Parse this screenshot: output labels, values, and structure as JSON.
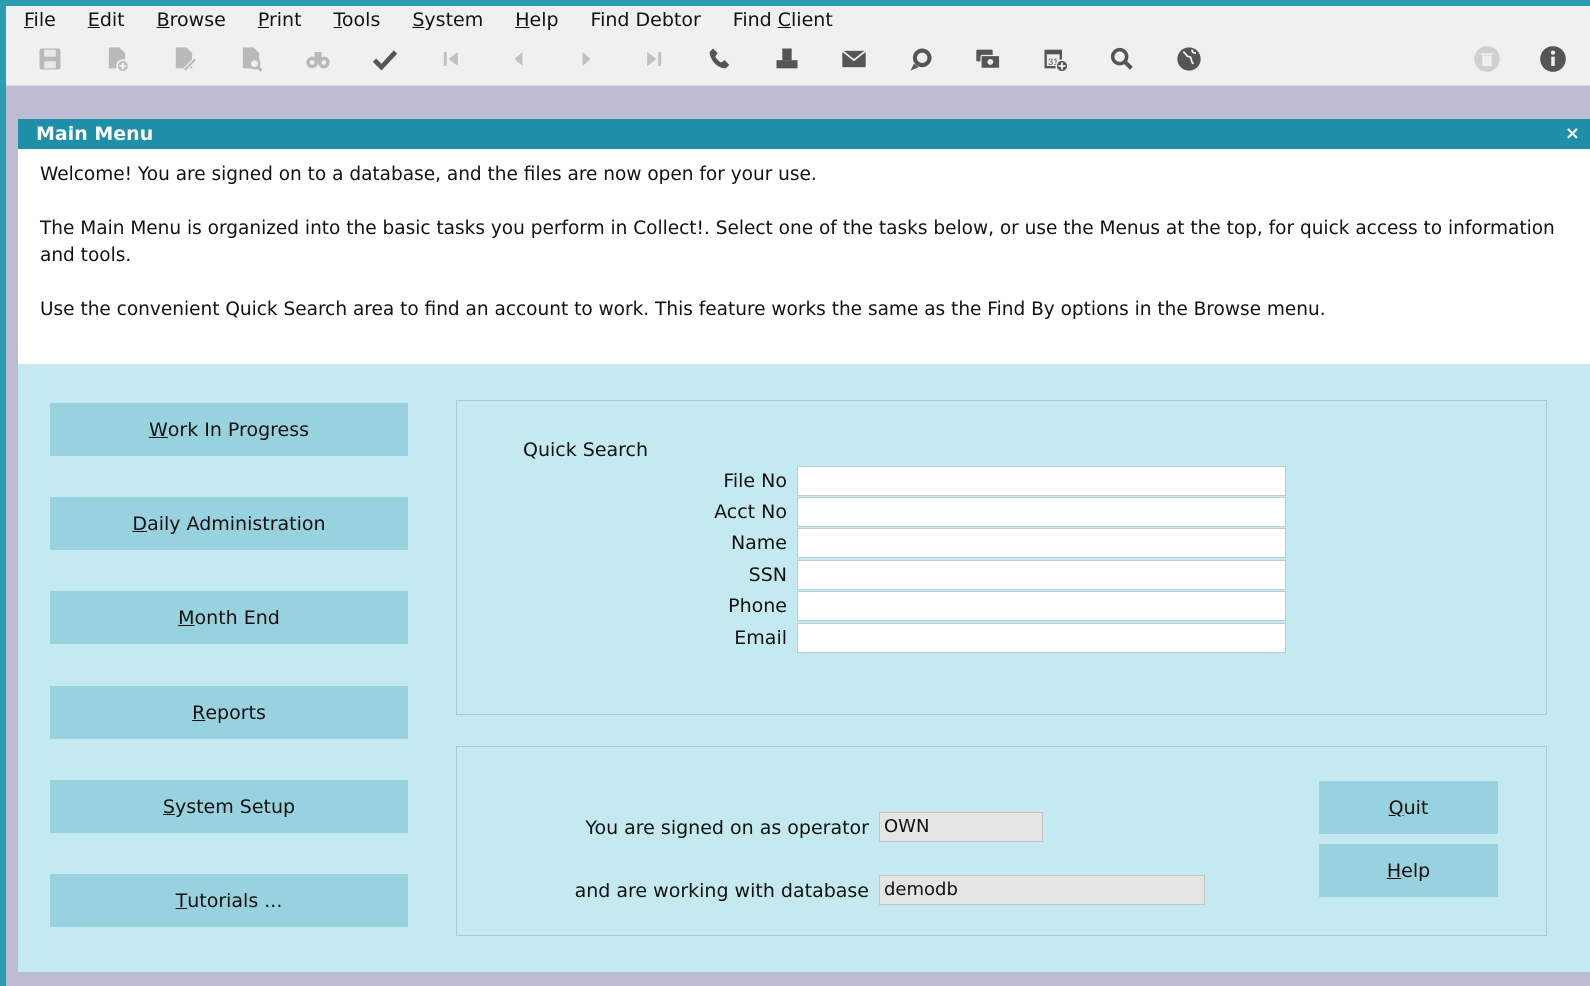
{
  "menubar": [
    {
      "ul": "F",
      "rest": "ile"
    },
    {
      "ul": "E",
      "rest": "dit"
    },
    {
      "ul": "B",
      "rest": "rowse"
    },
    {
      "ul": "P",
      "rest": "rint"
    },
    {
      "ul": "T",
      "rest": "ools"
    },
    {
      "ul": "S",
      "rest": "ystem"
    },
    {
      "ul": "H",
      "rest": "elp"
    },
    {
      "pre": "Find Debtor"
    },
    {
      "pre": "Find ",
      "ul": "C",
      "rest": "lient"
    }
  ],
  "toolbar": {
    "icons": [
      "save-icon",
      "new-record-icon",
      "edit-record-icon",
      "preview-icon",
      "find-icon",
      "checkmark-icon",
      "first-record-icon",
      "previous-record-icon",
      "next-record-icon",
      "last-record-icon",
      "phone-icon",
      "print-icon",
      "email-icon",
      "chat-icon",
      "payment-icon",
      "calendar-add-icon",
      "search-icon",
      "globe-icon",
      "delete-icon",
      "info-icon"
    ]
  },
  "window": {
    "title": "Main Menu",
    "close": "×"
  },
  "intro": {
    "p1": "Welcome! You are signed on to a database, and the files are now open for your use.",
    "p2": "The Main Menu is organized into the basic tasks you perform in Collect!. Select one of the tasks below, or use the Menus at the top, for quick access to information and tools.",
    "p3": "Use the convenient Quick Search area to find an account to work. This feature works the same as the Find By options in the Browse menu."
  },
  "nav": {
    "wip": {
      "ul": "W",
      "rest": "ork In Progress"
    },
    "daily": {
      "ul": "D",
      "rest": "aily Administration"
    },
    "month": {
      "ul": "M",
      "rest": "onth End"
    },
    "reports": {
      "ul": "R",
      "rest": "eports"
    },
    "setup": {
      "ul": "S",
      "rest": "ystem Setup"
    },
    "tutorials": {
      "ul": "T",
      "rest": "utorials ..."
    }
  },
  "quick_search": {
    "title": "Quick Search",
    "fields": {
      "file_no": {
        "label": "File No",
        "value": ""
      },
      "acct_no": {
        "label": "Acct No",
        "value": ""
      },
      "name": {
        "label": "Name",
        "value": ""
      },
      "ssn": {
        "label": "SSN",
        "value": ""
      },
      "phone": {
        "label": "Phone",
        "value": ""
      },
      "email": {
        "label": "Email",
        "value": ""
      }
    }
  },
  "signon": {
    "operator_label": "You are signed on as operator",
    "operator_value": "OWN",
    "database_label": "and are working with database",
    "database_value": "demodb"
  },
  "actions": {
    "quit": {
      "ul": "Q",
      "rest": "uit"
    },
    "help": {
      "ul": "H",
      "rest": "elp"
    }
  },
  "colors": {
    "title_bar": "#1d8fa8",
    "frame": "#2a9cb4",
    "panel_bg": "#c5e9f0",
    "button_bg": "#97d2de"
  }
}
